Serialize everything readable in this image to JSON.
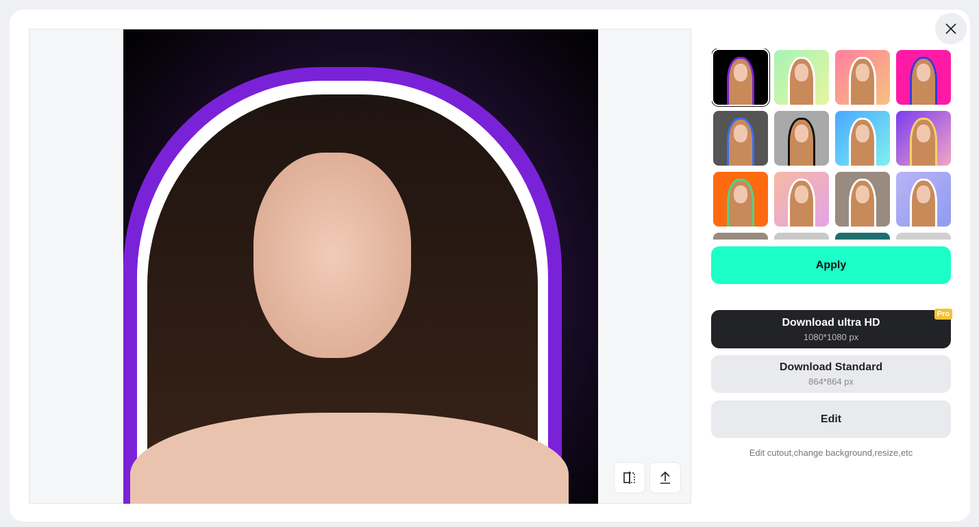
{
  "preview": {
    "tools": [
      {
        "icon": "compare-icon"
      },
      {
        "icon": "upload-icon"
      }
    ]
  },
  "close": {
    "icon": "close-icon"
  },
  "templates": [
    {
      "bg": "#000000",
      "outline": "#7a22d8",
      "selected": true
    },
    {
      "bg": "linear-gradient(135deg,#a6f3b5,#e8f5a0)",
      "outline": "#ffffff"
    },
    {
      "bg": "linear-gradient(135deg,#ff7f9e,#f8c27d)",
      "outline": "#ffffff"
    },
    {
      "bg": "#ff1aa6",
      "outline": "#3a3ad8"
    },
    {
      "bg": "#555555",
      "outline": "#3b6ef5"
    },
    {
      "bg": "#a9a9a9",
      "outline": "#111111"
    },
    {
      "bg": "linear-gradient(135deg,#4aa8ff,#7ff0f0)",
      "outline": "#ffffff"
    },
    {
      "bg": "linear-gradient(135deg,#7a3cf0,#f2a5c4)",
      "outline": "#f2d36b"
    },
    {
      "bg": "#ff6a10",
      "outline": "#4bd68a"
    },
    {
      "bg": "linear-gradient(135deg,#f7b9a0,#e4a3e8)",
      "outline": "#ffffff"
    },
    {
      "bg": "#9a8b80",
      "outline": "#ffffff"
    },
    {
      "bg": "linear-gradient(135deg,#b9b4f5,#8f9bf0)",
      "outline": "#ffffff"
    },
    {
      "bg": "#9a8b80",
      "outline": "#ffffff"
    },
    {
      "bg": "#c8c8c8",
      "outline": "#f2d36b"
    },
    {
      "bg": "#1f6e6e",
      "outline": "#ffffff"
    },
    {
      "bg": "#d0d0d0",
      "outline": "#1a7de0"
    }
  ],
  "actions": {
    "apply": "Apply",
    "download_hd": {
      "label": "Download ultra HD",
      "size": "1080*1080 px",
      "badge": "Pro"
    },
    "download_standard": {
      "label": "Download Standard",
      "size": "864*864 px"
    },
    "edit": "Edit",
    "edit_caption": "Edit cutout,change background,resize,etc"
  },
  "colors": {
    "accent": "#1cffc9",
    "dark": "#222327",
    "pro": "#f2c231"
  }
}
